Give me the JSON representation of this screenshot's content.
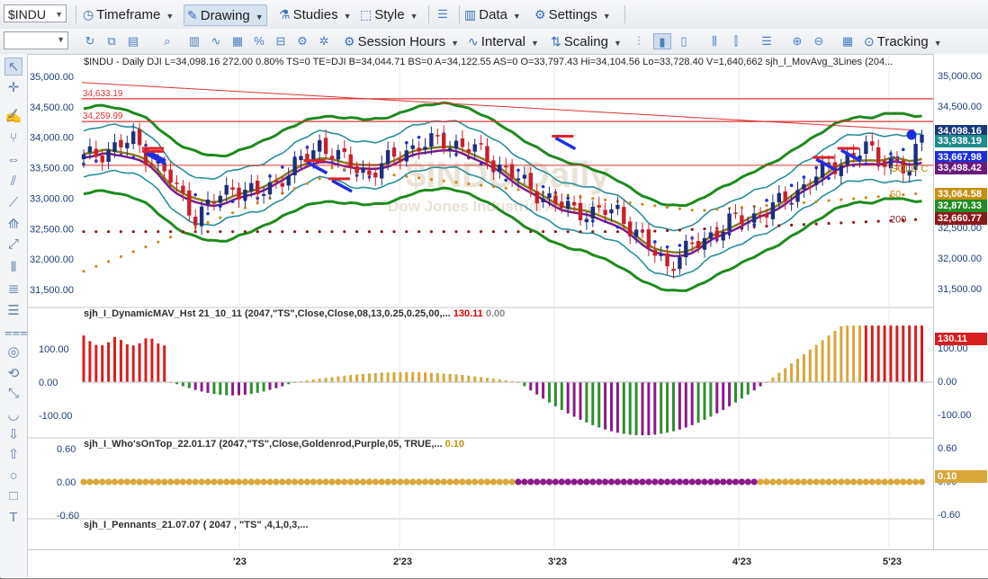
{
  "toolbar1": {
    "symbol": "$INDU",
    "menus": [
      "Timeframe",
      "Drawing",
      "Studies",
      "Style",
      "Data",
      "Settings"
    ]
  },
  "toolbar2": {
    "menus": [
      "Session Hours",
      "Interval",
      "Scaling",
      "Tracking"
    ]
  },
  "chart_header": "$INDU - Daily  DJI  L=34,098.16  272.00  0.80%  TS=0  TE=DJI  B=34,044.71  BS=0  A=34,122.55  AS=0  O=33,797.43  Hi=34,104.56  Lo=33,728.40  V=1,640,662  sjh_I_MovAvg_3Lines (204...",
  "watermark": {
    "symbol": "$INDU Daily",
    "name": "Dow Jones Industrial Average"
  },
  "price_axis": {
    "ticks": [
      "35,000.00",
      "34,500.00",
      "34,000.00",
      "33,500.00",
      "33,000.00",
      "32,500.00",
      "32,000.00",
      "31,500.00"
    ],
    "tick_values": [
      35000,
      34500,
      34000,
      33500,
      33000,
      32500,
      32000,
      31500
    ]
  },
  "price_tags": [
    {
      "text": "34,098.16",
      "value": 34098.16,
      "color": "#18397c"
    },
    {
      "text": "33,938.19",
      "value": 33938.19,
      "color": "#1f8b8b"
    },
    {
      "text": "33,667.98",
      "value": 33667.98,
      "color": "#1a2fe0"
    },
    {
      "text": "33,498.42",
      "value": 33498.42,
      "color": "#6a1b7c"
    },
    {
      "text": "33,064.58",
      "value": 33064.58,
      "color": "#c89010"
    },
    {
      "text": "32,870.33",
      "value": 32870.33,
      "color": "#228b22"
    },
    {
      "text": "32,660.77",
      "value": 32660.77,
      "color": "#8b1a1a"
    }
  ],
  "line_labels": [
    {
      "text": "34,633.19",
      "value": 34633.19,
      "color": "#d33"
    },
    {
      "text": "34,259.99",
      "value": 34259.99,
      "color": "#d33"
    }
  ],
  "ma_labels": [
    {
      "text": "21",
      "value": 33640,
      "color": "#1a2fe0"
    },
    {
      "text": "GOLD C",
      "value": 33490,
      "color": "#b38600"
    },
    {
      "text": "50",
      "value": 33070,
      "color": "#c89010"
    },
    {
      "text": "200",
      "value": 32660,
      "color": "#8b1a1a"
    }
  ],
  "panel2": {
    "title": "sjh_I_DynamicMAV_Hst 21_10_11 (2047,\"TS\",Close,Close,08,13,0.25,0.25,00,...",
    "value1": "130.11",
    "value2": "0.00",
    "axis": [
      "100.00",
      "0.00",
      "-100.00"
    ],
    "tag": "130.11"
  },
  "panel3": {
    "title": "sjh_I_Who'sOnTop_22.01.17 (2047,\"TS\",Close,Goldenrod,Purple,05, TRUE,...",
    "value1": "0.10",
    "axis": [
      "0.60",
      "0.00",
      "-0.60"
    ],
    "tag": "0.10"
  },
  "panel4": {
    "title": "sjh_I_Pennants_21.07.07 ( 2047 , \"TS\" ,4,1,0,3,..."
  },
  "time_axis": [
    "'23",
    "2'23",
    "3'23",
    "4'23",
    "5'23"
  ],
  "colors": {
    "up": "#1c2f7a",
    "down": "#c8202a",
    "hist_red": "#d81e1e",
    "hist_gold": "#d9a63a",
    "hist_purple": "#8b1a8b",
    "hist_green": "#2f8f2f"
  }
}
